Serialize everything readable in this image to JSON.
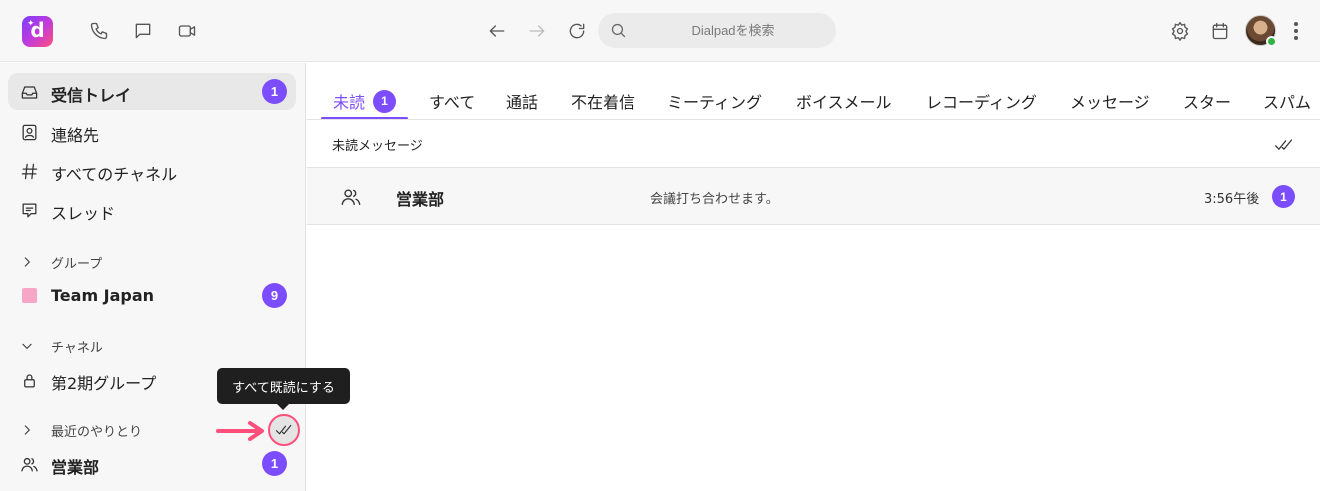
{
  "topbar": {
    "logo_letter": "d",
    "search_placeholder": "Dialpadを検索",
    "icons": [
      "phone-icon",
      "chat-icon",
      "video-icon",
      "back-arrow-icon",
      "forward-arrow-icon",
      "reload-icon",
      "search-icon",
      "gear-icon",
      "calendar-icon",
      "more-vertical-icon"
    ]
  },
  "sidebar": {
    "items": [
      {
        "label": "受信トレイ",
        "badge": "1",
        "icon": "inbox-icon"
      },
      {
        "label": "連絡先",
        "icon": "contacts-icon"
      },
      {
        "label": "すべてのチャネル",
        "icon": "hash-icon"
      },
      {
        "label": "スレッド",
        "icon": "thread-icon"
      }
    ],
    "groups_section": "グループ",
    "group_item": {
      "label": "Team Japan",
      "badge": "9"
    },
    "channels_section": "チャネル",
    "channel_item": {
      "label": "第2期グループ",
      "icon": "lock-icon"
    },
    "recent_section": "最近のやりとり",
    "recent_item": {
      "label": "営業部",
      "badge": "1",
      "icon": "group-icon"
    },
    "tooltip": "すべて既読にする"
  },
  "tabs": [
    {
      "label": "未読",
      "badge": "1",
      "active": true
    },
    {
      "label": "すべて"
    },
    {
      "label": "通話"
    },
    {
      "label": "不在着信"
    },
    {
      "label": "ミーティング"
    },
    {
      "label": "ボイスメール"
    },
    {
      "label": "レコーディング"
    },
    {
      "label": "メッセージ"
    },
    {
      "label": "スター"
    },
    {
      "label": "スパム"
    }
  ],
  "main": {
    "subheader": "未読メッセージ",
    "rows": [
      {
        "name": "営業部",
        "preview": "会議打ち合わせます。",
        "time": "3:56午後",
        "badge": "1"
      }
    ]
  },
  "colors": {
    "accent": "#7c4dff",
    "highlight": "#ff4f7a"
  }
}
